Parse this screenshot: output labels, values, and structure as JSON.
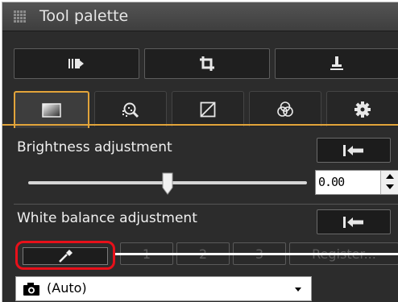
{
  "palette": {
    "title": "Tool palette",
    "top_buttons": [
      {
        "icon": "vignette-icon"
      },
      {
        "icon": "crop-icon"
      },
      {
        "icon": "stamp-icon"
      }
    ],
    "tabs": [
      {
        "icon": "basic-adjust-icon",
        "active": true
      },
      {
        "icon": "noise-reduction-icon",
        "active": false
      },
      {
        "icon": "tone-curve-icon",
        "active": false
      },
      {
        "icon": "color-adjust-icon",
        "active": false
      },
      {
        "icon": "settings-gear-icon",
        "active": false
      }
    ],
    "accent_color": "#e2a43a",
    "highlight_color": "#e8101a"
  },
  "brightness": {
    "label": "Brightness adjustment",
    "value": "0.00",
    "slider_fraction": 0.5
  },
  "white_balance": {
    "label": "White balance adjustment",
    "buttons": [
      "1",
      "2",
      "3",
      "Register..."
    ],
    "mode_value": "(Auto)"
  }
}
